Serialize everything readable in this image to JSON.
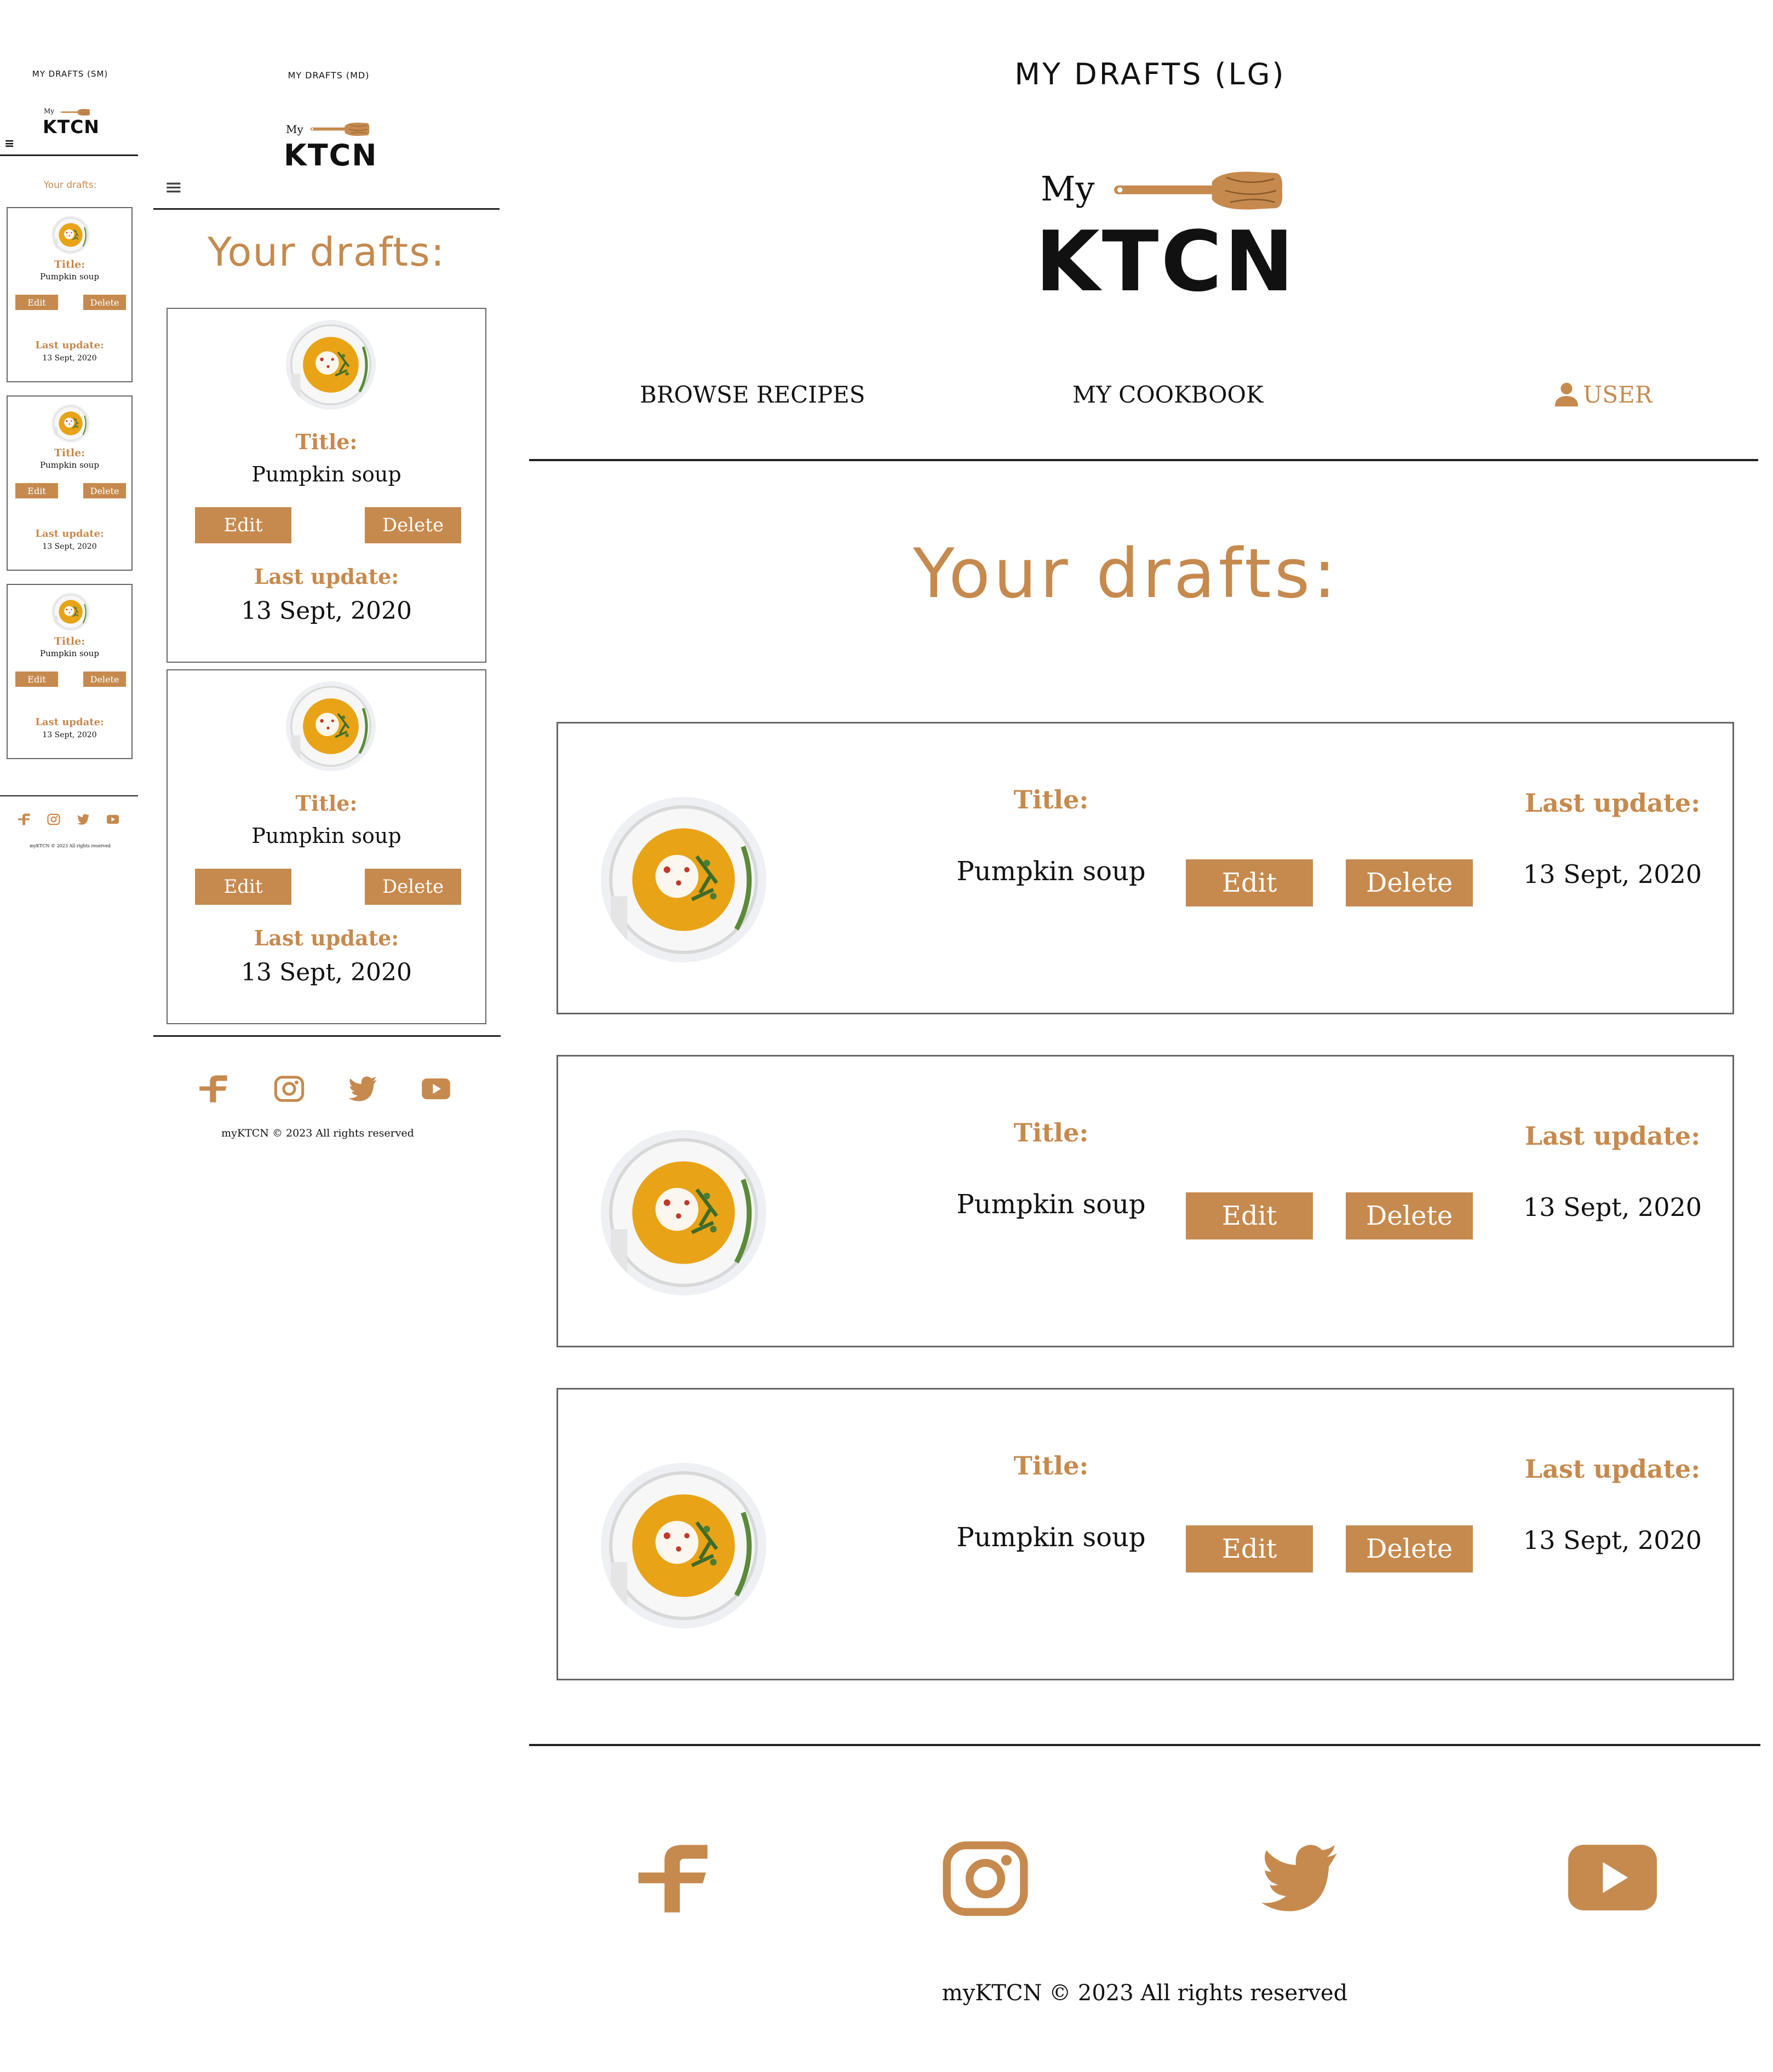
{
  "colors": {
    "accent": "#C68A4E",
    "text": "#111111",
    "border": "#666666"
  },
  "sm": {
    "frame_title": "MY DRAFTS (SM)",
    "logo_my": "My",
    "logo_ktcn": "KTCN",
    "heading": "Your drafts:",
    "cards": [
      {
        "title_label": "Title:",
        "title": "Pumpkin soup",
        "edit": "Edit",
        "delete": "Delete",
        "update_label": "Last update:",
        "date": "13 Sept, 2020"
      },
      {
        "title_label": "Title:",
        "title": "Pumpkin soup",
        "edit": "Edit",
        "delete": "Delete",
        "update_label": "Last update:",
        "date": "13 Sept, 2020"
      },
      {
        "title_label": "Title:",
        "title": "Pumpkin soup",
        "edit": "Edit",
        "delete": "Delete",
        "update_label": "Last update:",
        "date": "13 Sept, 2020"
      }
    ],
    "copyright": "myKTCN © 2023 All rights reserved"
  },
  "md": {
    "frame_title": "MY DRAFTS (MD)",
    "logo_my": "My",
    "logo_ktcn": "KTCN",
    "heading": "Your drafts:",
    "cards": [
      {
        "title_label": "Title:",
        "title": "Pumpkin soup",
        "edit": "Edit",
        "delete": "Delete",
        "update_label": "Last update:",
        "date": "13 Sept, 2020"
      },
      {
        "title_label": "Title:",
        "title": "Pumpkin soup",
        "edit": "Edit",
        "delete": "Delete",
        "update_label": "Last update:",
        "date": "13 Sept, 2020"
      }
    ],
    "copyright": "myKTCN © 2023 All rights reserved"
  },
  "lg": {
    "frame_title": "MY DRAFTS (LG)",
    "logo_my": "My",
    "logo_ktcn": "KTCN",
    "nav": {
      "browse": "BROWSE RECIPES",
      "cookbook": "MY COOKBOOK",
      "user": "USER"
    },
    "heading": "Your drafts:",
    "cards": [
      {
        "title_label": "Title:",
        "title": "Pumpkin soup",
        "edit": "Edit",
        "delete": "Delete",
        "update_label": "Last update:",
        "date": "13 Sept, 2020"
      },
      {
        "title_label": "Title:",
        "title": "Pumpkin soup",
        "edit": "Edit",
        "delete": "Delete",
        "update_label": "Last update:",
        "date": "13 Sept, 2020"
      },
      {
        "title_label": "Title:",
        "title": "Pumpkin soup",
        "edit": "Edit",
        "delete": "Delete",
        "update_label": "Last update:",
        "date": "13 Sept, 2020"
      }
    ],
    "copyright": "myKTCN © 2023 All rights reserved"
  },
  "icons": [
    "facebook-icon",
    "instagram-icon",
    "twitter-icon",
    "youtube-icon",
    "user-icon",
    "hamburger-menu-icon",
    "spoon-logo-icon"
  ]
}
